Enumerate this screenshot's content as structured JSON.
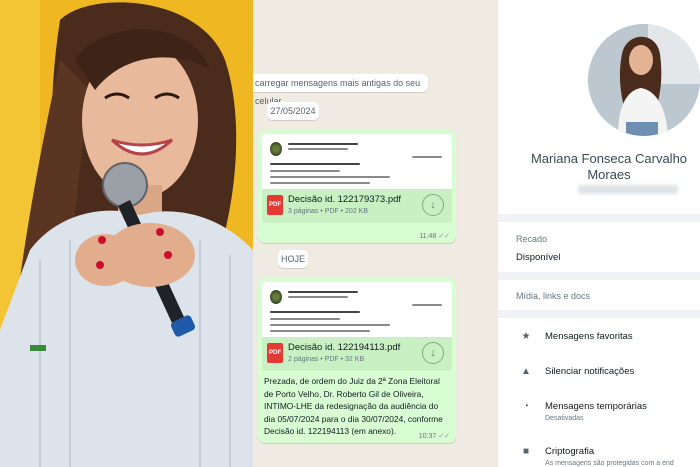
{
  "chat": {
    "load_older": "carregar mensagens mais antigas do seu celular.",
    "date_1": "27/05/2024",
    "date_2": "HOJE",
    "messages": [
      {
        "file_name": "Decisão id. 122179373.pdf",
        "file_meta": "3 páginas • PDF • 202 KB",
        "time": "11:48",
        "icon": "pdf-icon"
      },
      {
        "file_name": "Decisão id. 122194113.pdf",
        "file_meta": "2 páginas • PDF • 32 KB",
        "time": "10:37",
        "icon": "pdf-icon",
        "text": "Prezada, de ordem do Juiz da 2ª Zona Eleitoral de Porto Velho, Dr. Roberto Gil de Oliveira, INTIMO-LHE da redesignação da audiência do dia 05/07/2024 para o dia 30/07/2024, conforme Decisão id. 122194113 (em anexo)."
      }
    ],
    "pdf_badge": "PDF",
    "download_icon": "download-icon"
  },
  "contact": {
    "name": "Mariana Fonseca Carvalho Moraes",
    "about_label": "Recado",
    "about_value": "Disponível",
    "media_label": "Mídia, links e docs",
    "options": [
      {
        "icon": "star-icon",
        "glyph": "★",
        "label": "Mensagens favoritas",
        "sub": ""
      },
      {
        "icon": "bell-icon",
        "glyph": "🔔",
        "label": "Silenciar notificações",
        "sub": ""
      },
      {
        "icon": "timer-icon",
        "glyph": "◔",
        "label": "Mensagens temporárias",
        "sub": "Desativadas"
      },
      {
        "icon": "lock-icon",
        "glyph": "🔒",
        "label": "Criptografia",
        "sub": "As mensagens são protegidas com a end"
      }
    ]
  },
  "colors": {
    "bubble": "#d9fdd3",
    "chat_bg": "#efeae2",
    "pdf_red": "#e53935",
    "photo_bg": "#f2c12e"
  }
}
